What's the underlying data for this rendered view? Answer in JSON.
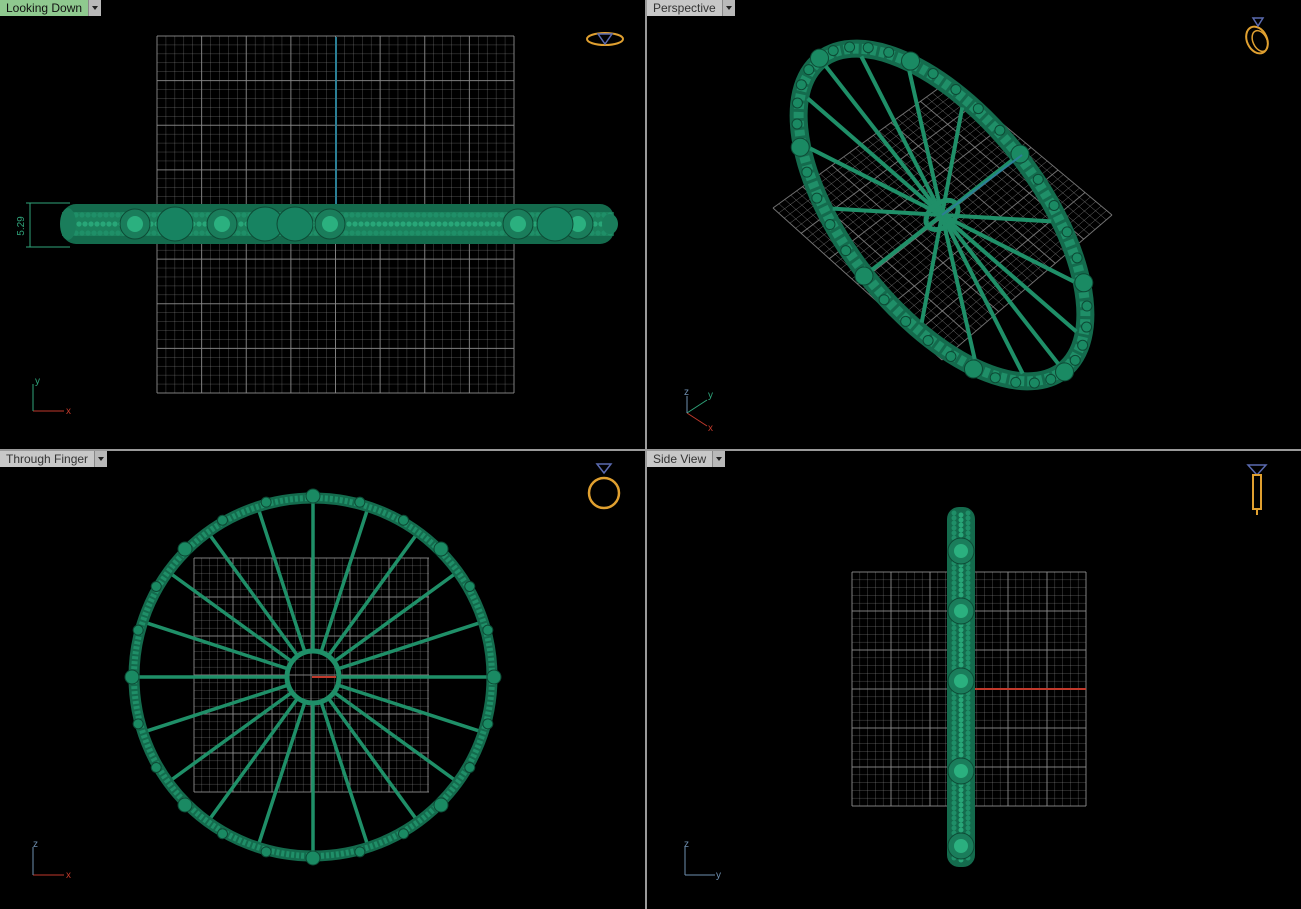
{
  "viewports": [
    {
      "id": "top",
      "title": "Looking Down",
      "active": true,
      "axes": {
        "first": "x",
        "second": "y"
      }
    },
    {
      "id": "perspective",
      "title": "Perspective",
      "active": false,
      "axes": {
        "first": "x",
        "second": "y",
        "third": "z"
      }
    },
    {
      "id": "front",
      "title": "Through Finger",
      "active": false,
      "axes": {
        "first": "x",
        "second": "z"
      }
    },
    {
      "id": "side",
      "title": "Side View",
      "active": false,
      "axes": {
        "first": "y",
        "second": "z"
      }
    }
  ],
  "dimension": {
    "value": "5.29"
  },
  "colors": {
    "background": "#000000",
    "model": "#1f8f68",
    "grid": "#8c8c8c",
    "axis_x": "#c0392b",
    "axis_y": "#2fa37a",
    "axis_z": "#6e8fb0",
    "nav_icon": "#e0a030",
    "active_tab": "#8fc98f",
    "tab": "#c8c8c8"
  },
  "icons": [
    "ring-top-icon",
    "ring-perspective-icon",
    "ring-front-icon",
    "ring-side-icon"
  ]
}
